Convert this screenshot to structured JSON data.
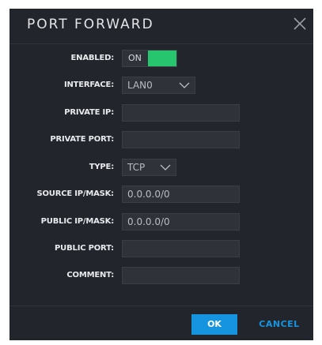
{
  "dialog": {
    "title": "PORT FORWARD",
    "close_icon": "close-icon"
  },
  "fields": {
    "enabled": {
      "label": "ENABLED:",
      "state": "ON",
      "on": true,
      "accent": "#27c56d"
    },
    "interface": {
      "label": "INTERFACE:",
      "value": "LAN0"
    },
    "private_ip": {
      "label": "PRIVATE IP:",
      "value": ""
    },
    "private_port": {
      "label": "PRIVATE PORT:",
      "value": ""
    },
    "type": {
      "label": "TYPE:",
      "value": "TCP"
    },
    "source_ip_mask": {
      "label": "SOURCE IP/MASK:",
      "value": "0.0.0.0/0"
    },
    "public_ip_mask": {
      "label": "PUBLIC IP/MASK:",
      "value": "0.0.0.0/0"
    },
    "public_port": {
      "label": "PUBLIC PORT:",
      "value": ""
    },
    "comment": {
      "label": "COMMENT:",
      "value": ""
    }
  },
  "buttons": {
    "ok": "OK",
    "cancel": "CANCEL",
    "accent": "#1694e0"
  }
}
